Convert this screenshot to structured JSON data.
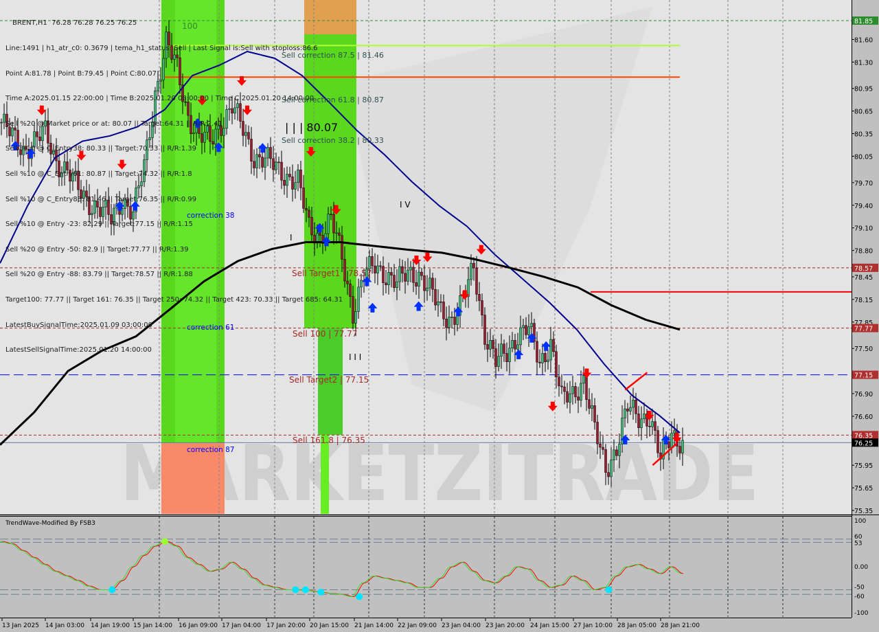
{
  "header": {
    "title": "BRENT,H1  76.28 76.28 76.25 76.25",
    "lines": [
      "Line:1491 | h1_atr_c0: 0.3679 | tema_h1_status: Sell | Last Signal is:Sell with stoploss:86.6",
      "Point A:81.78 | Point B:79.45 | Point C:80.07",
      "Time A:2025.01.15 22:00:00 | Time B:2025.01.20 08:00:00 | Time C:2025.01.20 14:00:00",
      "Sell %20 @ Market price or at: 80.07 || Target:64.31 || R/R:2.41",
      "Sell %10 @ C_Entry38: 80.33 || Target:70.33 || R/R:1.39",
      "Sell %10 @ C_Entry61: 80.87 || Target:74.32 || R/R:1.8",
      "Sell %10 @ C_Entry88: 81.46 || Target:76.35 || R/R:0.99",
      "Sell %10 @ Entry -23: 82.29 || Target:77.15 || R/R:1.15",
      "Sell %20 @ Entry -50: 82.9 || Target:77.77 || R/R:1.39",
      "Sell %20 @ Entry -88: 83.79 || Target:78.57 || R/R:1.88",
      "Target100: 77.77 || Target 161: 76.35 || Target 250: 74.32 || Target 423: 70.33 || Target 685: 64.31",
      "LatestBuySignalTime:2025.01.09 03:00:00",
      "LatestSellSignalTime:2025.01.20 14:00:00"
    ]
  },
  "watermark": "MARKETZITRADE",
  "chart_data": {
    "type": "candlestick",
    "symbol": "BRENT",
    "timeframe": "H1",
    "y_ticks": [
      "81.60",
      "81.30",
      "80.95",
      "80.65",
      "80.35",
      "80.05",
      "79.70",
      "79.40",
      "79.10",
      "78.80",
      "78.45",
      "78.15",
      "77.85",
      "77.50",
      "76.90",
      "76.60",
      "75.95",
      "75.65",
      "75.35"
    ],
    "ylim": [
      75.3,
      82.1
    ],
    "x_ticks": [
      "13 Jan 2025",
      "14 Jan 03:00",
      "14 Jan 19:00",
      "15 Jan 14:00",
      "16 Jan 09:00",
      "17 Jan 04:00",
      "17 Jan 20:00",
      "20 Jan 15:00",
      "21 Jan 14:00",
      "22 Jan 09:00",
      "23 Jan 04:00",
      "23 Jan 20:00",
      "24 Jan 15:00",
      "27 Jan 10:00",
      "28 Jan 05:00",
      "28 Jan 21:00"
    ],
    "close_series_4h": [
      80.5,
      80.3,
      80.15,
      80.25,
      80.35,
      80.0,
      79.85,
      79.6,
      79.45,
      79.35,
      79.2,
      79.5,
      79.3,
      79.9,
      80.9,
      81.55,
      81.2,
      80.6,
      80.3,
      80.25,
      80.5,
      80.7,
      80.4,
      80.05,
      80.0,
      79.9,
      79.8,
      79.7,
      79.1,
      79.0,
      79.2,
      78.7,
      78.0,
      78.45,
      78.6,
      78.5,
      78.35,
      78.5,
      78.5,
      78.25,
      78.0,
      77.9,
      78.1,
      78.6,
      77.7,
      77.3,
      77.45,
      77.7,
      77.75,
      77.3,
      77.6,
      76.8,
      76.9,
      77.1,
      76.4,
      75.9,
      76.2,
      76.7,
      76.6,
      76.6,
      76.0,
      76.4,
      76.25
    ],
    "ma_fast_blue": [
      78.63,
      79.39,
      80.03,
      80.25,
      80.32,
      80.44,
      80.67,
      81.12,
      81.26,
      81.44,
      81.35,
      81.12,
      80.76,
      80.39,
      80.07,
      79.71,
      79.39,
      79.12,
      78.75,
      78.43,
      78.11,
      77.75,
      77.29,
      76.88,
      76.61,
      76.38
    ],
    "ma_slow_black": [
      76.22,
      76.65,
      77.2,
      77.47,
      77.66,
      78.02,
      78.39,
      78.66,
      78.82,
      78.91,
      78.91,
      78.86,
      78.81,
      78.77,
      78.68,
      78.57,
      78.45,
      78.31,
      78.07,
      77.88,
      77.75
    ],
    "price_labels": [
      {
        "value": "81.85",
        "color": "#2e8b2e"
      },
      {
        "value": "78.57",
        "color": "#b03030"
      },
      {
        "value": "77.77",
        "color": "#b03030"
      },
      {
        "value": "77.15",
        "color": "#b03030"
      },
      {
        "value": "76.35",
        "color": "#b03030"
      },
      {
        "value": "76.25",
        "color": "#000000"
      }
    ],
    "levels": [
      {
        "price": 81.85,
        "style": "dashed",
        "color": "#2e8b2e"
      },
      {
        "price": 81.52,
        "style": "solid",
        "color": "#adff2f"
      },
      {
        "price": 81.1,
        "style": "solid",
        "color": "#ff4500"
      },
      {
        "price": 78.57,
        "style": "dashed",
        "color": "#a52a2a"
      },
      {
        "price": 78.25,
        "style": "solid",
        "color": "#ff0000"
      },
      {
        "price": 77.77,
        "style": "dashed",
        "color": "#a52a2a"
      },
      {
        "price": 77.15,
        "style": "longdash",
        "color": "#0000ff"
      },
      {
        "price": 76.35,
        "style": "dashed",
        "color": "#a52a2a"
      },
      {
        "price": 76.25,
        "style": "solid",
        "color": "#6080a0"
      }
    ],
    "annotations": [
      {
        "text": "Sell correction 87.5 | 81.46",
        "color": "#2f4f4f"
      },
      {
        "text": "Sell correction 61.8 | 80.87",
        "color": "#2f4f4f"
      },
      {
        "text": "| | | 80.07",
        "color": "#000000"
      },
      {
        "text": "Sell correction 38.2 | 80.33",
        "color": "#2f4f4f"
      },
      {
        "text": "I V",
        "color": "#000000"
      },
      {
        "text": "I",
        "color": "#000000"
      },
      {
        "text": "I I I",
        "color": "#000000"
      },
      {
        "text": "Sell Target1 | 78.57",
        "color": "#a52a2a"
      },
      {
        "text": "Sell 100 | 77.77",
        "color": "#a52a2a"
      },
      {
        "text": "Sell Target2 | 77.15",
        "color": "#a52a2a"
      },
      {
        "text": "Sell 161.8 | 76.35",
        "color": "#a52a2a"
      },
      {
        "text": "correction 38",
        "color": "#0000ff"
      },
      {
        "text": "correction 61",
        "color": "#0000ff"
      },
      {
        "text": "correction 87",
        "color": "#0000ff"
      },
      {
        "text": "100",
        "color": "#2e8b2e"
      }
    ],
    "sell_signals": [
      [
        3.8,
        80.65
      ],
      [
        7.4,
        80.05
      ],
      [
        11.1,
        79.93
      ],
      [
        18.4,
        80.78
      ],
      [
        22,
        81.04
      ],
      [
        22.5,
        80.65
      ],
      [
        28.3,
        80.1
      ],
      [
        30.6,
        79.33
      ],
      [
        37.9,
        78.66
      ],
      [
        38.9,
        78.7
      ],
      [
        43.8,
        78.8
      ],
      [
        42.3,
        78.2
      ],
      [
        50.3,
        76.72
      ],
      [
        53.4,
        77.16
      ],
      [
        59.1,
        76.6
      ],
      [
        61.6,
        76.3
      ]
    ],
    "buy_signals": [
      [
        1.4,
        80.2
      ],
      [
        2.8,
        80.1
      ],
      [
        10.9,
        79.4
      ],
      [
        12.3,
        79.4
      ],
      [
        18,
        80.5
      ],
      [
        19.9,
        80.18
      ],
      [
        23.9,
        80.17
      ],
      [
        29.1,
        79.11
      ],
      [
        29.7,
        78.93
      ],
      [
        33.4,
        78.4
      ],
      [
        33.9,
        78.05
      ],
      [
        38.1,
        78.07
      ],
      [
        41.7,
        78.0
      ],
      [
        47.2,
        77.43
      ],
      [
        48.4,
        77.65
      ],
      [
        49.7,
        77.54
      ],
      [
        56.9,
        76.3
      ],
      [
        60.6,
        76.3
      ]
    ],
    "pattern_lines": [
      [
        [
          56.9,
          76.95
        ],
        [
          58.9,
          77.18
        ]
      ],
      [
        [
          59.4,
          75.95
        ],
        [
          61.6,
          76.24
        ]
      ]
    ],
    "colors": {
      "bull": "#3cb878",
      "bear": "#9b1b30",
      "ma_fast": "#00008b",
      "ma_slow": "#000000",
      "zone_green": "#5ad81e",
      "zone_orange": "#e0a050",
      "zone_salmon": "#f88a6a"
    },
    "indicator": {
      "title": "TrendWave-Modified By FSB3",
      "y_ticks": [
        "100",
        "60",
        "53",
        "0.00",
        "-50",
        "-60",
        "-100"
      ],
      "ylim": [
        -100,
        100
      ],
      "levels": [
        60,
        53,
        -50,
        -60
      ],
      "wave_4h": [
        55,
        50,
        35,
        20,
        5,
        -10,
        -20,
        -30,
        -42,
        -50,
        -50,
        -30,
        0,
        25,
        45,
        55,
        45,
        20,
        5,
        -10,
        -5,
        10,
        -5,
        -25,
        -40,
        -45,
        -50,
        -50,
        -52,
        -55,
        -58,
        -60,
        -65,
        -35,
        -20,
        -25,
        -30,
        -35,
        -45,
        -45,
        -25,
        0,
        10,
        -10,
        -30,
        -35,
        -20,
        0,
        -5,
        -30,
        -45,
        -40,
        -20,
        -30,
        -50,
        -45,
        -20,
        0,
        5,
        -5,
        -15,
        0,
        -15
      ],
      "markers_cyan": [
        [
          10.2,
          -50
        ],
        [
          26.9,
          -50
        ],
        [
          27.8,
          -50
        ],
        [
          29.2,
          -55
        ],
        [
          32.7,
          -65
        ],
        [
          55.4,
          -50
        ]
      ],
      "markers_lime": [
        [
          15,
          55
        ]
      ]
    }
  }
}
